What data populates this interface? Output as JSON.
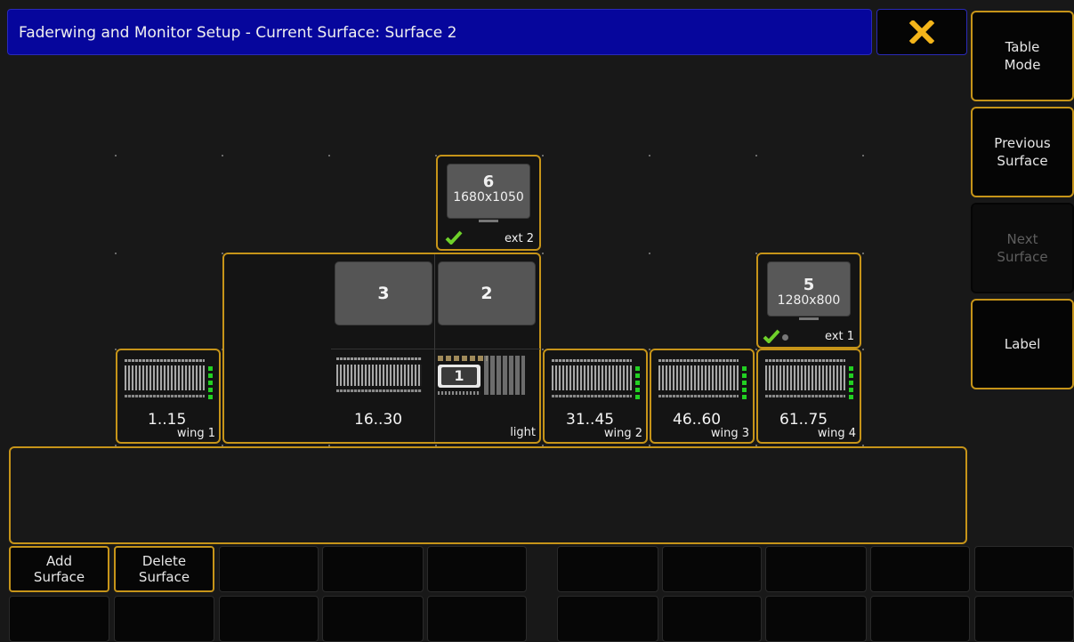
{
  "title": "Faderwing and Monitor Setup - Current Surface: Surface 2",
  "close_icon": "x-icon",
  "side_buttons": [
    {
      "label": "Table\nMode",
      "enabled": true
    },
    {
      "label": "Previous\nSurface",
      "enabled": true
    },
    {
      "label": "Next\nSurface",
      "enabled": false
    },
    {
      "label": "Label",
      "enabled": true
    }
  ],
  "monitors": [
    {
      "number": "6",
      "resolution": "1680x1050",
      "output": "ext 2",
      "active": true
    },
    {
      "number": "5",
      "resolution": "1280x800",
      "output": "ext 1",
      "active": true
    }
  ],
  "console": {
    "screens": [
      "3",
      "2"
    ],
    "screen_one": "1",
    "range": "16..30",
    "label": "light"
  },
  "wings": [
    {
      "range": "1..15",
      "label": "wing 1"
    },
    {
      "range": "31..45",
      "label": "wing 2"
    },
    {
      "range": "46..60",
      "label": "wing 3"
    },
    {
      "range": "61..75",
      "label": "wing 4"
    }
  ],
  "bottom_buttons": {
    "add_surface": "Add\nSurface",
    "delete_surface": "Delete\nSurface"
  },
  "colors": {
    "accent": "#c69419",
    "title_bar": "#06069c",
    "led_green": "#22d022"
  }
}
